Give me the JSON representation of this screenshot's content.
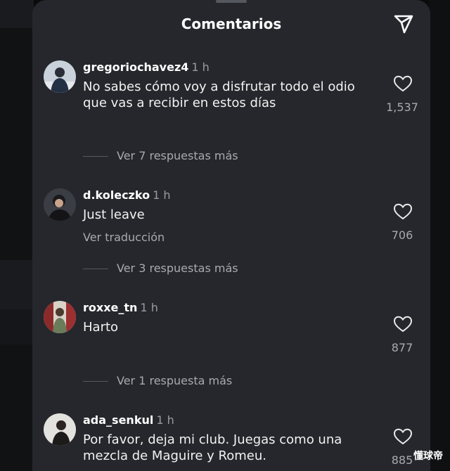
{
  "header": {
    "title": "Comentarios"
  },
  "comments": [
    {
      "username": "gregoriochavez4",
      "time": "1 h",
      "text": "No sabes cómo voy a disfrutar todo el odio que vas a recibir en estos días",
      "likes": "1,537",
      "replies": "Ver 7 respuestas más"
    },
    {
      "username": "d.koleczko",
      "time": "1 h",
      "text": "Just leave",
      "translate": "Ver traducción",
      "likes": "706",
      "replies": "Ver 3 respuestas más"
    },
    {
      "username": "roxxe_tn",
      "time": "1 h",
      "text": "Harto",
      "likes": "877",
      "replies": "Ver 1 respuesta más"
    },
    {
      "username": "ada_senkul",
      "time": "1 h",
      "text": "Por favor, deja mi club. Juegas como una mezcla de Maguire y Romeu.",
      "likes": "885"
    }
  ],
  "watermark": "懂球帝",
  "colors": {
    "sheet": "#25272c",
    "muted": "#a8aab0",
    "text": "#f2f2f2"
  }
}
